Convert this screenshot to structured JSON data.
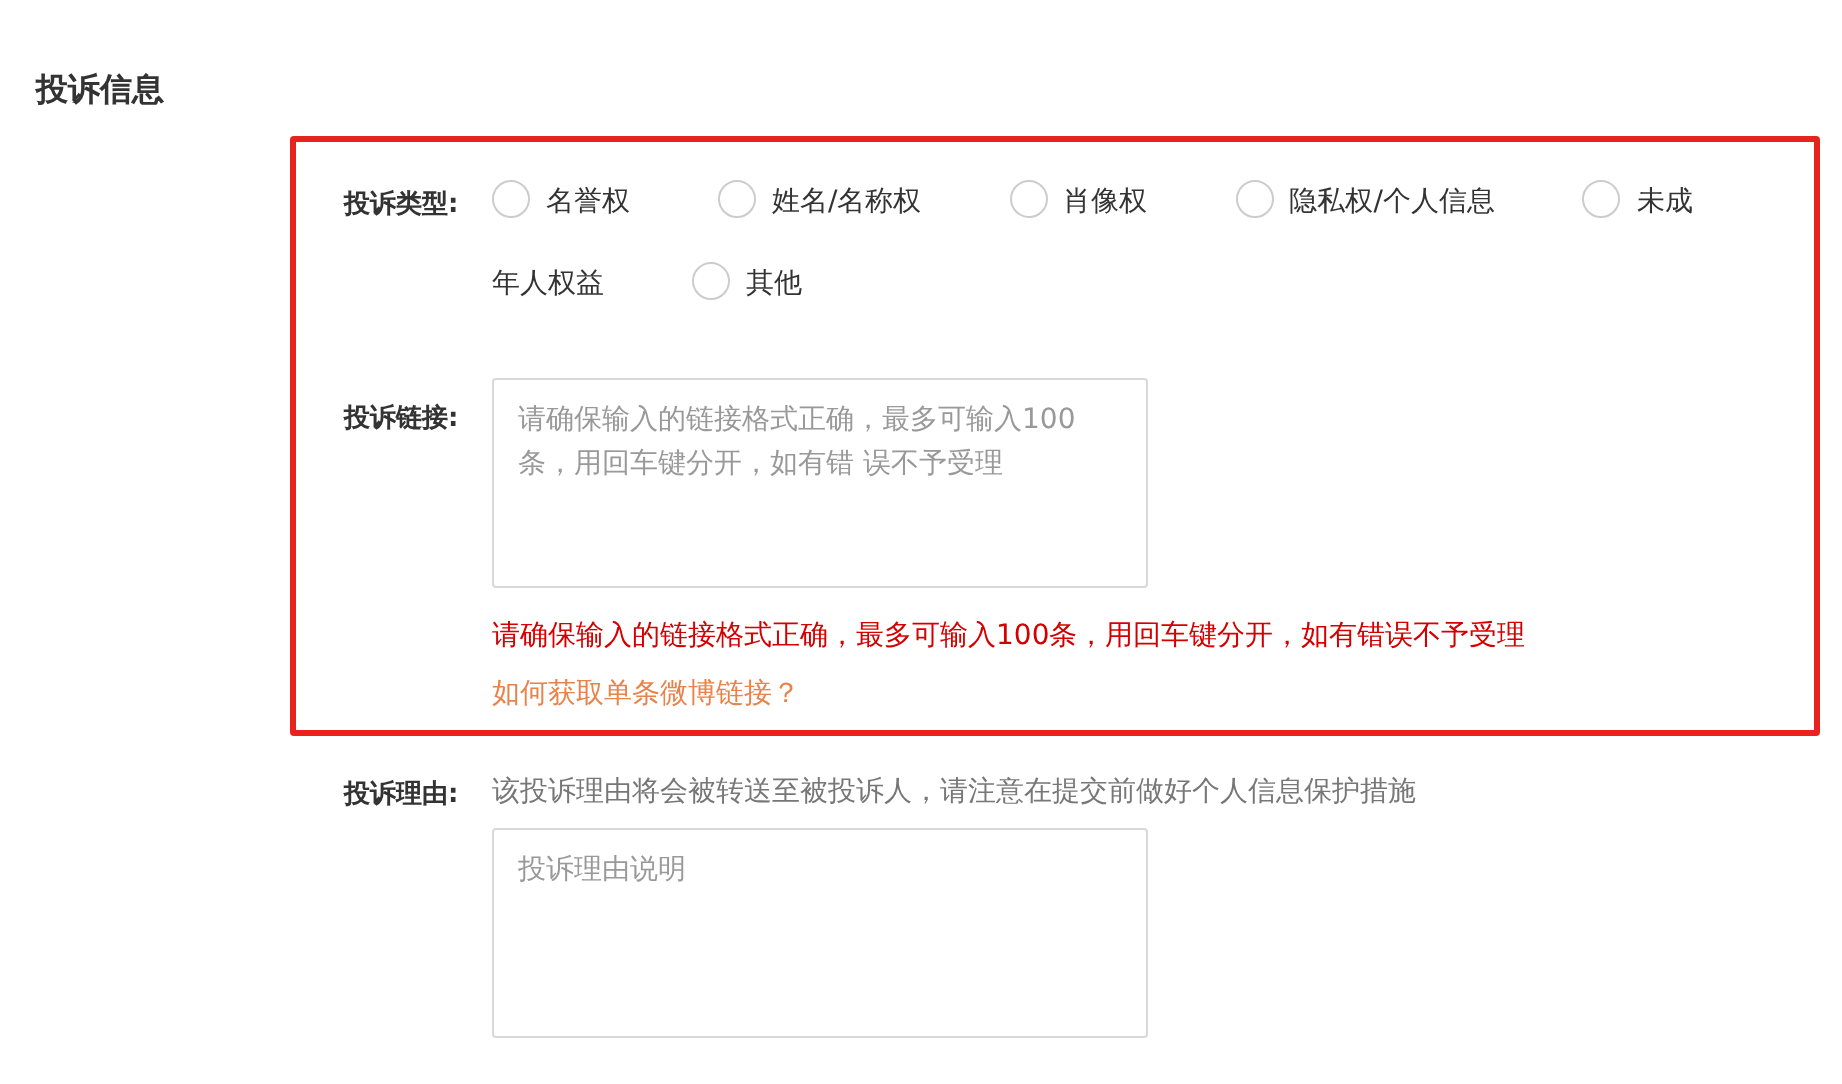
{
  "section_title": "投诉信息",
  "complaint_type": {
    "label": "投诉类型:",
    "options": [
      {
        "label_lines": [
          "名誉权"
        ],
        "selected": false
      },
      {
        "label_lines": [
          "姓名/名称权"
        ],
        "selected": false
      },
      {
        "label_lines": [
          "肖像权"
        ],
        "selected": false
      },
      {
        "label_lines": [
          "隐私权/个人信息"
        ],
        "selected": false
      },
      {
        "label_lines": [
          "未成",
          "年人权益"
        ],
        "selected": false
      },
      {
        "label_lines": [
          "其他"
        ],
        "selected": false
      }
    ]
  },
  "complaint_links": {
    "label": "投诉链接:",
    "placeholder": "请确保输入的链接格式正确，最多可输入100条，用回车键分开，如有错 误不予受理",
    "error": "请确保输入的链接格式正确，最多可输入100条，用回车键分开，如有错误不予受理",
    "help_link": "如何获取单条微博链接？"
  },
  "complaint_reason": {
    "label": "投诉理由:",
    "hint": "该投诉理由将会被转送至被投诉人，请注意在提交前做好个人信息保护措施",
    "placeholder": "投诉理由说明"
  }
}
